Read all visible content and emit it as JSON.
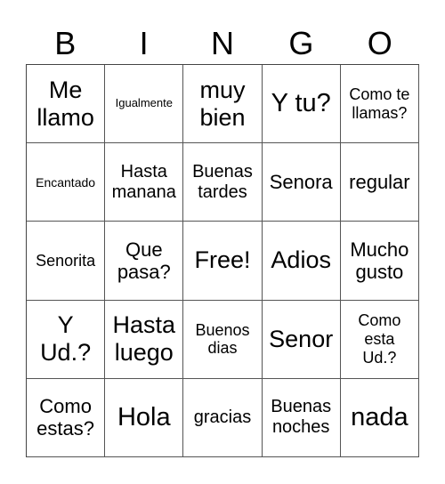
{
  "header": [
    "B",
    "I",
    "N",
    "G",
    "O"
  ],
  "cells": [
    "Me llamo",
    "Igualmente",
    "muy bien",
    "Y tu?",
    "Como te llamas?",
    "Encantado",
    "Hasta manana",
    "Buenas tardes",
    "Senora",
    "regular",
    "Senorita",
    "Que pasa?",
    "Free!",
    "Adios",
    "Mucho gusto",
    "Y Ud.?",
    "Hasta luego",
    "Buenos dias",
    "Senor",
    "Como esta Ud.?",
    "Como estas?",
    "Hola",
    "gracias",
    "Buenas noches",
    "nada"
  ]
}
